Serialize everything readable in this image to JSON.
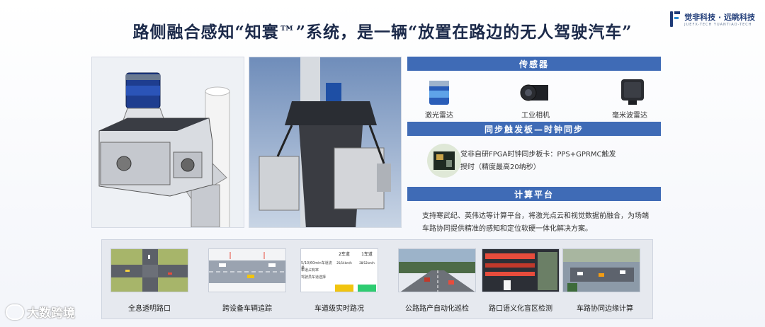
{
  "title": "路侧融合感知“知寰™”系统，是一辆“放置在路边的无人驾驶汽车”",
  "logo": {
    "cn": "觉非科技 · 远眺科技",
    "en": "JUEFX-TECH   YUANTIAO-TECH"
  },
  "sections": {
    "sensor": {
      "title": "传感器",
      "items": [
        {
          "label": "激光雷达",
          "icon": "lidar-icon"
        },
        {
          "label": "工业相机",
          "icon": "industrial-camera-icon"
        },
        {
          "label": "毫米波雷达",
          "icon": "mmwave-radar-icon"
        }
      ]
    },
    "sync": {
      "title": "同步触发板—时钟同步",
      "line1": "觉非自研FPGA时钟同步板卡：PPS+GPRMC触发",
      "line2": "授时（精度最高20纳秒）"
    },
    "compute": {
      "title": "计算平台",
      "line1": "支持寒武纪、英伟达等计算平台，将激光点云和视觉数据前融合，为场端",
      "line2": "车路协同提供精准的感知和定位软硬一体化解决方案。"
    }
  },
  "scenarios": [
    {
      "label": "全息透明路口"
    },
    {
      "label": "跨设备车辆追踪"
    },
    {
      "label": "车道级实时路况"
    },
    {
      "label": "公路路产自动化巡检"
    },
    {
      "label": "路口语义化盲区检测"
    },
    {
      "label": "车路协同边缘计算"
    }
  ],
  "lane_table": {
    "col1": "2车道",
    "col2": "1车道",
    "rows": [
      {
        "label": "",
        "v1": "25/14km/h",
        "v2": "28/12km/h"
      },
      {
        "label": "5/10/60min车道流量",
        "v1": "",
        "v2": ""
      },
      {
        "label": "车道占有率",
        "v1": "",
        "v2": ""
      },
      {
        "label": "驾驶员车道选择",
        "v1": "",
        "v2": ""
      }
    ]
  },
  "watermark": "大数跨境",
  "colors": {
    "accent": "#3f6bb6",
    "title": "#1c2a4a",
    "strip": "#e6e9ef"
  }
}
